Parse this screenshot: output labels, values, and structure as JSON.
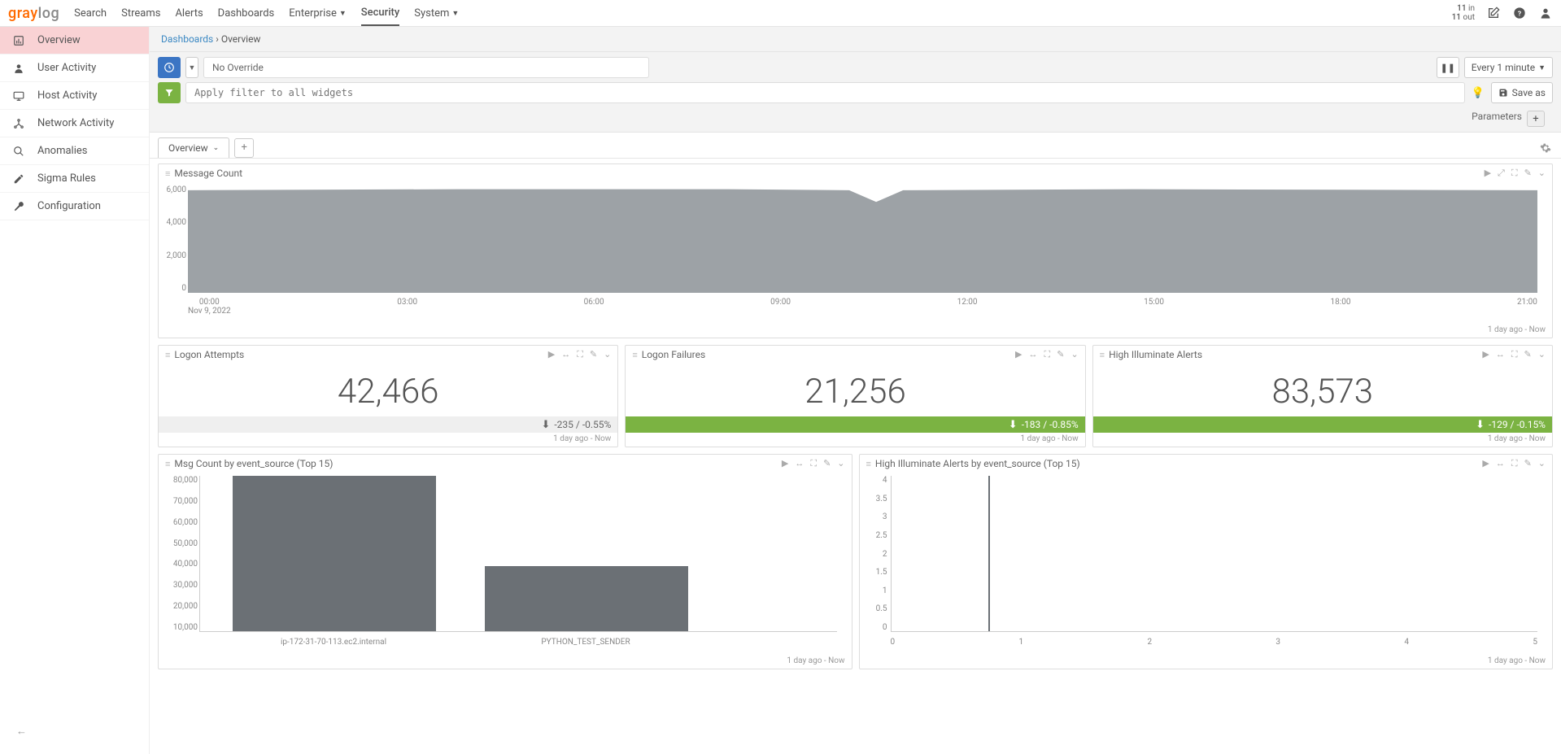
{
  "brand": {
    "part1": "gray",
    "part2": "log"
  },
  "nav": [
    "Search",
    "Streams",
    "Alerts",
    "Dashboards",
    "Enterprise",
    "Security",
    "System"
  ],
  "nav_active": "Security",
  "io": {
    "in": "11",
    "out": "11",
    "in_lbl": "in",
    "out_lbl": "out"
  },
  "sidebar": [
    {
      "label": "Overview",
      "active": true
    },
    {
      "label": "User Activity"
    },
    {
      "label": "Host Activity"
    },
    {
      "label": "Network Activity"
    },
    {
      "label": "Anomalies"
    },
    {
      "label": "Sigma Rules"
    },
    {
      "label": "Configuration"
    }
  ],
  "crumb": {
    "root": "Dashboards",
    "sep": "›",
    "leaf": "Overview"
  },
  "toolbar": {
    "override": "No Override",
    "refresh": "Every 1 minute",
    "filter_ph": "Apply filter to all widgets",
    "saveas": "Save as",
    "params": "Parameters"
  },
  "tab": "Overview",
  "range_label": "1 day ago - Now",
  "widgets": {
    "mc": {
      "title": "Message Count",
      "yticks": [
        "6,000",
        "4,000",
        "2,000",
        "0"
      ],
      "xticks": [
        "00:00",
        "03:00",
        "06:00",
        "09:00",
        "12:00",
        "15:00",
        "18:00",
        "21:00"
      ],
      "date": "Nov 9, 2022"
    },
    "la": {
      "title": "Logon Attempts",
      "value": "42,466",
      "trend": "-235 / -0.55%"
    },
    "lf": {
      "title": "Logon Failures",
      "value": "21,256",
      "trend": "-183 / -0.85%"
    },
    "hi": {
      "title": "High Illuminate Alerts",
      "value": "83,573",
      "trend": "-129 / -0.15%"
    },
    "msgsrc": {
      "title": "Msg Count by event_source (Top 15)",
      "yticks": [
        "80,000",
        "70,000",
        "60,000",
        "50,000",
        "40,000",
        "30,000",
        "20,000",
        "10,000"
      ],
      "bars": [
        {
          "label": "ip-172-31-70-113.ec2.internal",
          "h": 100
        },
        {
          "label": "PYTHON_TEST_SENDER",
          "h": 42
        }
      ]
    },
    "hisrc": {
      "title": "High Illuminate Alerts by event_source (Top 15)",
      "yticks": [
        "4",
        "3.5",
        "3",
        "2.5",
        "2",
        "1.5",
        "1",
        "0.5",
        "0"
      ],
      "xticks": [
        "0",
        "1",
        "2",
        "3",
        "4",
        "5"
      ]
    }
  },
  "chart_data": [
    {
      "type": "area",
      "title": "Message Count",
      "xlabel": "",
      "ylabel": "",
      "ylim": [
        0,
        6000
      ],
      "x": [
        "00:00",
        "03:00",
        "06:00",
        "09:00",
        "12:00",
        "15:00",
        "18:00",
        "21:00"
      ],
      "values": [
        5800,
        5850,
        5850,
        5800,
        5150,
        5850,
        5850,
        5800
      ],
      "date": "Nov 9, 2022"
    },
    {
      "type": "bar",
      "title": "Msg Count by event_source (Top 15)",
      "categories": [
        "ip-172-31-70-113.ec2.internal",
        "PYTHON_TEST_SENDER"
      ],
      "values": [
        80000,
        34000
      ],
      "ylim": [
        0,
        80000
      ]
    },
    {
      "type": "bar",
      "title": "High Illuminate Alerts by event_source (Top 15)",
      "categories": [
        "0",
        "1",
        "2",
        "3",
        "4",
        "5"
      ],
      "values": [
        4,
        0,
        0,
        0,
        0,
        0
      ],
      "ylim": [
        0,
        4
      ]
    }
  ]
}
